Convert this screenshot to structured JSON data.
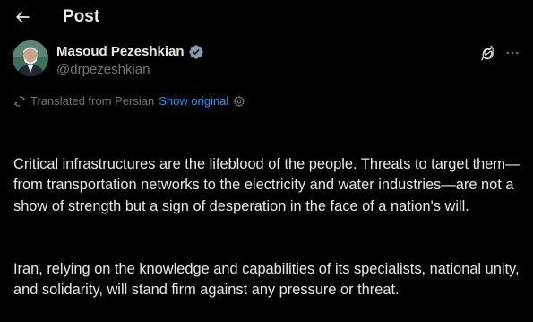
{
  "header": {
    "title": "Post",
    "back_icon": "arrow-left-icon"
  },
  "author": {
    "name": "Masoud Pezeshkian",
    "handle": "@drpezeshkian",
    "verified_icon": "verified-badge-icon",
    "verified_color": "#829aab"
  },
  "actions": {
    "grok_icon": "grok-icon",
    "more_icon": "more-horizontal-icon"
  },
  "translation": {
    "label": "Translated from Persian",
    "show_original": "Show original",
    "link_color": "#1d9bf0"
  },
  "post": {
    "paragraphs": [
      "Critical infrastructures are the lifeblood of the people. Threats to target them—from transportation networks to the electricity and water industries—are not a show of strength but a sign of desperation in the face of a nation's will.",
      "Iran, relying on the knowledge and capabilities of its specialists, national unity, and solidarity, will stand firm against any pressure or threat."
    ]
  },
  "colors": {
    "background": "#000000",
    "text": "#e7e9ea",
    "secondary": "#71767b"
  }
}
